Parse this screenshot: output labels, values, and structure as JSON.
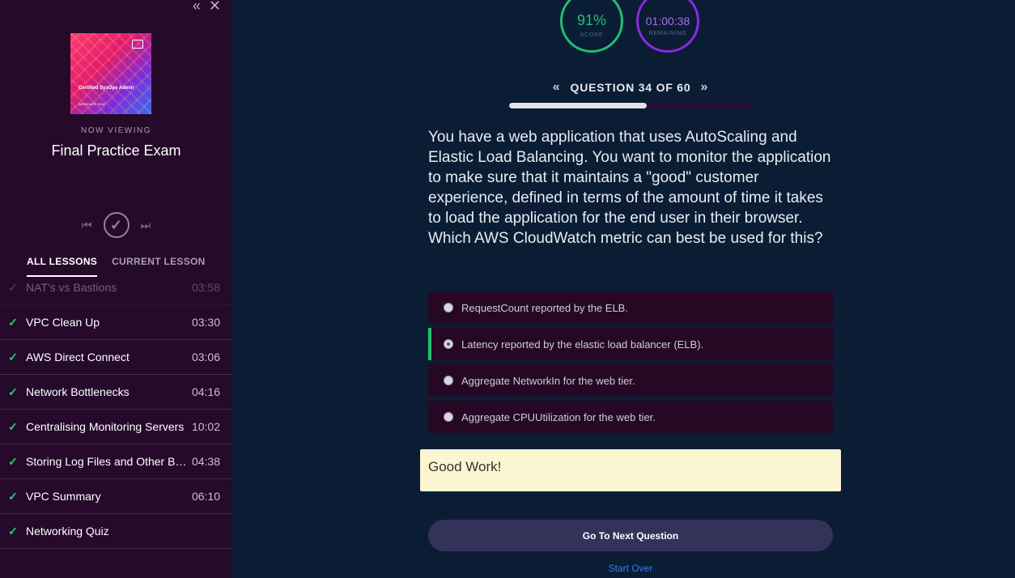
{
  "sidebar": {
    "controls": {
      "collapse": "«",
      "close": "✕"
    },
    "cover": {
      "title": "Certified SysOps Admin",
      "subtitle": "ASSOCIATE 2018"
    },
    "now_viewing": "NOW VIEWING",
    "course_title": "Final Practice Exam",
    "tabs": {
      "all": "ALL LESSONS",
      "current": "CURRENT LESSON"
    },
    "lessons": [
      {
        "name": "NAT's vs Bastions",
        "duration": "03:58"
      },
      {
        "name": "VPC Clean Up",
        "duration": "03:30"
      },
      {
        "name": "AWS Direct Connect",
        "duration": "03:06"
      },
      {
        "name": "Network Bottlenecks",
        "duration": "04:16"
      },
      {
        "name": "Centralising Monitoring Servers",
        "duration": "10:02"
      },
      {
        "name": "Storing Log Files and Other Ba...",
        "duration": "04:38"
      },
      {
        "name": "VPC Summary",
        "duration": "06:10"
      },
      {
        "name": "Networking Quiz",
        "duration": ""
      }
    ]
  },
  "stats": {
    "score": "91%",
    "score_label": "SCORE",
    "time": "01:00:38",
    "time_label": "REMAINING"
  },
  "quiz": {
    "question_label": "QUESTION 34 OF 60",
    "progress_fraction": 0.567,
    "question": "You have a web application that uses AutoScaling and Elastic Load Balancing. You want to monitor the application to make sure that it maintains a \"good\" customer experience, defined in terms of the amount of time it takes to load the application for the end user in their browser. Which AWS CloudWatch metric can best be used for this?",
    "answers": [
      "RequestCount reported by the ELB.",
      "Latency reported by the elastic load balancer (ELB).",
      "Aggregate NetworkIn for the web tier.",
      "Aggregate CPUUtilization for the web tier."
    ],
    "selected_index": 1,
    "feedback": "Good Work!",
    "next_button": "Go To Next Question",
    "start_over": "Start Over"
  },
  "colors": {
    "accent_green": "#1fc06f",
    "accent_purple": "#8a2be2",
    "sidebar_bg": "#250a2a",
    "main_bg": "#0b1d34"
  }
}
